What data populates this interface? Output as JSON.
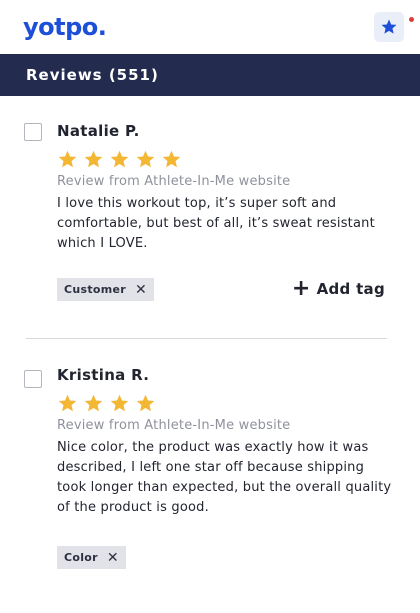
{
  "app": {
    "logo": "yotpo.",
    "star_button_icon": "star-icon"
  },
  "header": {
    "title": "Reviews (551)"
  },
  "colors": {
    "header_bg": "#232b4e",
    "logo": "#1e4fd8",
    "star_filled": "#f3b733",
    "tag_bg": "#e2e3e8"
  },
  "reviews": [
    {
      "name": "Natalie P.",
      "rating": 5,
      "source": "Review from Athlete-In-Me website",
      "text": "I love this workout top, it’s super soft and comfortable, but best of all, it’s sweat resistant which I LOVE.",
      "tags": [
        "Customer"
      ],
      "add_tag_label": "Add tag"
    },
    {
      "name": "Kristina R.",
      "rating": 4,
      "source": "Review from Athlete-In-Me website",
      "text": "Nice color, the product was exactly how it was described, I left one star off because shipping took longer than expected, but the overall quality of the product is good.",
      "tags": [
        "Color"
      ]
    }
  ]
}
